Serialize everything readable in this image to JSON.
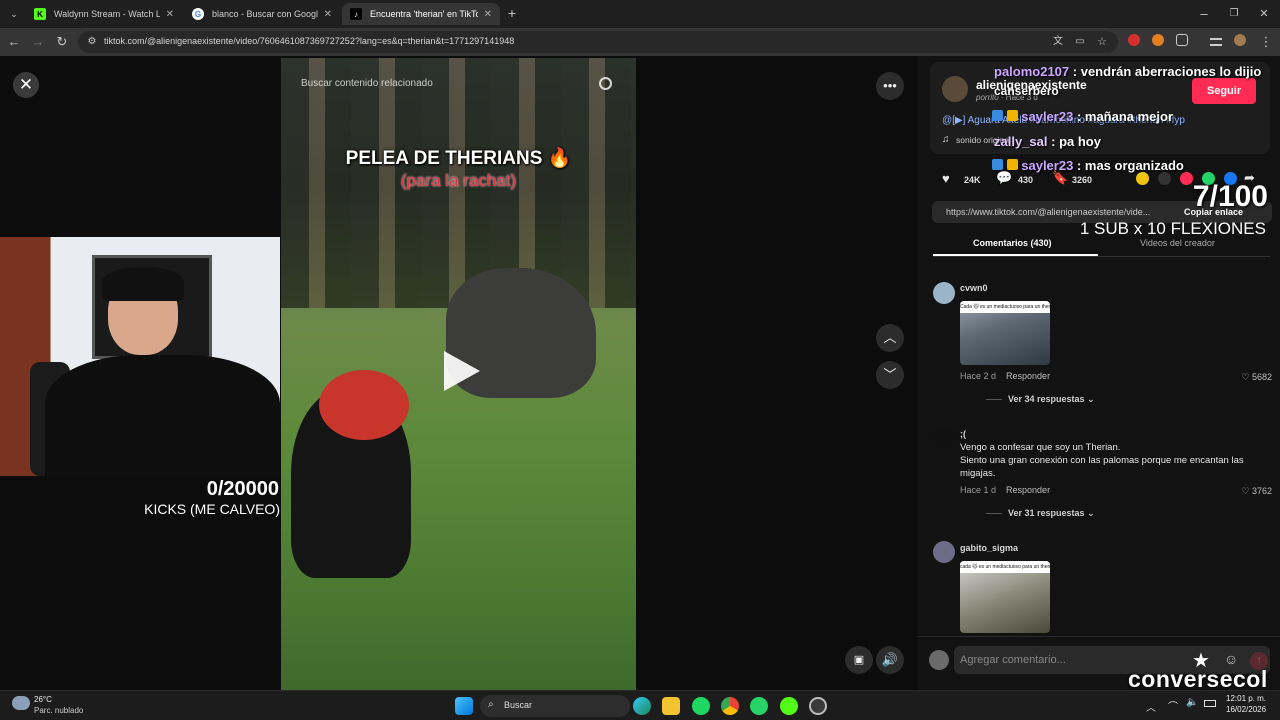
{
  "browser": {
    "tabs": [
      {
        "title": "Waldynn Stream - Watch Live o",
        "active": false,
        "favicon_color": "#53fc18"
      },
      {
        "title": "blanco - Buscar con Google",
        "active": false,
        "favicon_color": "#ffffff"
      },
      {
        "title": "Encuentra 'therian' en TikTok | ...",
        "active": true,
        "favicon_color": "#000000"
      }
    ],
    "new_tab_symbol": "+",
    "url": "tiktok.com/@alienigenaexistente/video/7606461087369727252?lang=es&q=therian&t=1771297141948"
  },
  "video": {
    "search_placeholder": "Buscar contenido relacionado",
    "caption_title": "PELEA DE THERIANS",
    "caption_subtitle": "(para la rachat)",
    "fire_emoji": "🔥"
  },
  "stream_overlay": {
    "kicks_count": "0/20000",
    "kicks_label": "KICKS (ME CALVEO)",
    "counter": "7/100",
    "sub_rule": "1 SUB x 10 FLEXIONES",
    "watermark": "conversecol"
  },
  "author": {
    "username": "alienigenaexistente",
    "nickname": "porrito",
    "posted": "Hace 3 d",
    "follow_label": "Seguir",
    "description": "@[▶] Aguara Akela #barriochino #aguara #therian #fyp",
    "sound": "sonido original"
  },
  "chat_messages": [
    {
      "user": "palomo2107",
      "text": ": vendrán aberraciones lo dijio"
    },
    {
      "user": "",
      "text": "canserbero"
    },
    {
      "user": "sayler23",
      "text": ": mañana mejor"
    },
    {
      "user": "zally_sal",
      "text": ": pa hoy"
    },
    {
      "user": "sayler23",
      "text": ": mas organizado"
    }
  ],
  "stats": {
    "likes": "24K",
    "comments": "430",
    "saves": "3260"
  },
  "share_link": {
    "url": "https://www.tiktok.com/@alienigenaexistente/vide...",
    "copy_label": "Copiar enlace"
  },
  "tabs": {
    "comments": "Comentarios (430)",
    "creator_videos": "Videos del creador"
  },
  "comments": [
    {
      "user": "cvwn0",
      "text": "",
      "time": "Hace 2 d",
      "reply": "Responder",
      "likes": "5682",
      "replies": "Ver 34 respuestas",
      "image_caption": "Cada 🐱 es un mediactuoso para un therian"
    },
    {
      "user": ";(",
      "text": "Vengo a confesar que soy un Therian.\nSiento una gran conexión con las palomas porque me encantan las migajas.",
      "time": "Hace 1 d",
      "reply": "Responder",
      "likes": "3762",
      "replies": "Ver 31 respuestas"
    },
    {
      "user": "gabito_sigma",
      "text": "",
      "image_caption": "cada 🐱 es un mediactuoso para un therian"
    }
  ],
  "comment_input": {
    "placeholder": "Agregar comentario..."
  },
  "taskbar": {
    "weather_temp": "26°C",
    "weather_desc": "Parc. nublado",
    "search_label": "Buscar",
    "date": "16/02/2026",
    "time": "12:01 p. m."
  },
  "colors": {
    "follow_button": "#fe2c55",
    "chat_name": "#c9a6ff",
    "background": "#121212"
  }
}
